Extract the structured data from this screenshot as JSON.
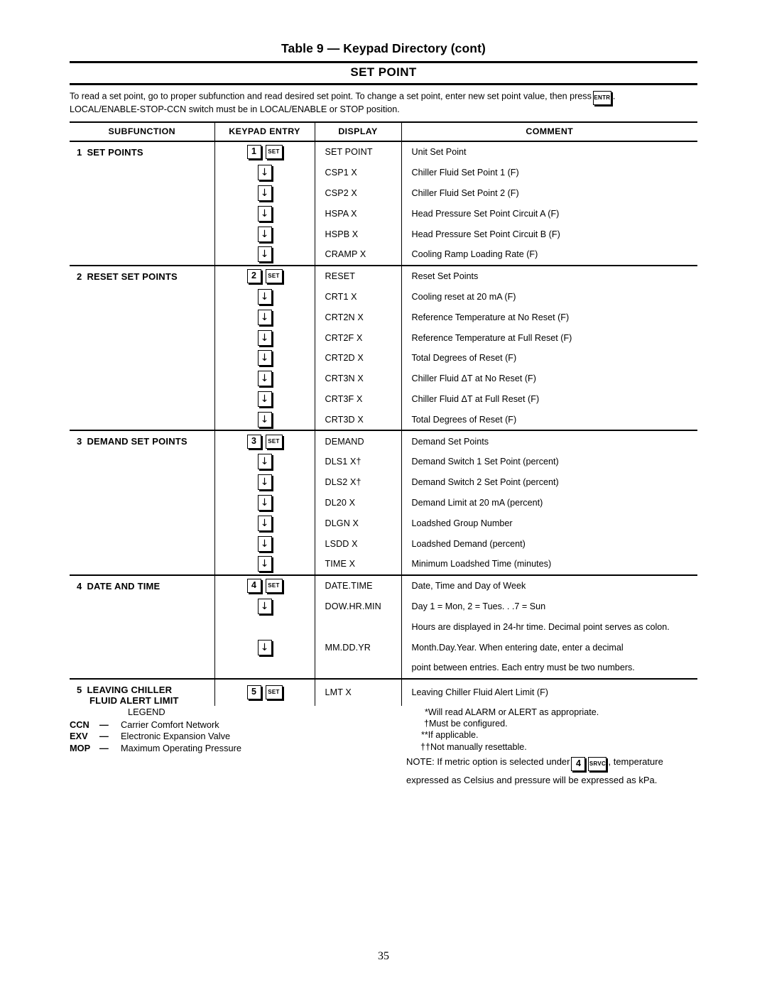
{
  "document": {
    "table_title": "Table 9 — Keypad Directory (cont)",
    "banner": "SET POINT",
    "page_number": "35",
    "intro_line1": "To read a set point, go to proper subfunction and read desired set point. To change a set point, enter new set point value, then press",
    "intro_after_key": ".",
    "intro_line2": "LOCAL/ENABLE-STOP-CCN switch must be in LOCAL/ENABLE or STOP position.",
    "intro_key": "ENTR"
  },
  "table": {
    "headers": {
      "subfunction": "SUBFUNCTION",
      "keypad_entry": "KEYPAD ENTRY",
      "display": "DISPLAY",
      "comment": "COMMENT"
    },
    "sections": [
      {
        "num": "1",
        "name": "SET POINTS",
        "name_line2": "",
        "rows": [
          {
            "key_num": "1",
            "key_label": "SET",
            "key_arrow": "",
            "display": "SET POINT",
            "comment": "Unit Set Point"
          },
          {
            "key_num": "",
            "key_label": "",
            "key_arrow": "↓",
            "display": "CSP1 X",
            "comment": "Chiller Fluid Set Point 1 (F)"
          },
          {
            "key_num": "",
            "key_label": "",
            "key_arrow": "↓",
            "display": "CSP2 X",
            "comment": "Chiller Fluid Set Point 2 (F)"
          },
          {
            "key_num": "",
            "key_label": "",
            "key_arrow": "↓",
            "display": "HSPA X",
            "comment": "Head Pressure Set Point Circuit A (F)"
          },
          {
            "key_num": "",
            "key_label": "",
            "key_arrow": "↓",
            "display": "HSPB X",
            "comment": "Head Pressure Set Point Circuit B (F)"
          },
          {
            "key_num": "",
            "key_label": "",
            "key_arrow": "↓",
            "display": "CRAMP X",
            "comment": "Cooling Ramp Loading Rate (F)"
          }
        ]
      },
      {
        "num": "2",
        "name": "RESET SET POINTS",
        "name_line2": "",
        "rows": [
          {
            "key_num": "2",
            "key_label": "SET",
            "key_arrow": "",
            "display": "RESET",
            "comment": "Reset Set Points"
          },
          {
            "key_num": "",
            "key_label": "",
            "key_arrow": "↓",
            "display": "CRT1 X",
            "comment": "Cooling reset at 20 mA (F)"
          },
          {
            "key_num": "",
            "key_label": "",
            "key_arrow": "↓",
            "display": "CRT2N X",
            "comment": "Reference Temperature at No Reset (F)"
          },
          {
            "key_num": "",
            "key_label": "",
            "key_arrow": "↓",
            "display": "CRT2F X",
            "comment": "Reference Temperature at Full Reset (F)"
          },
          {
            "key_num": "",
            "key_label": "",
            "key_arrow": "↓",
            "display": "CRT2D X",
            "comment": "Total Degrees of Reset (F)"
          },
          {
            "key_num": "",
            "key_label": "",
            "key_arrow": "↓",
            "display": "CRT3N X",
            "comment": "Chiller Fluid ΔT at No Reset (F)"
          },
          {
            "key_num": "",
            "key_label": "",
            "key_arrow": "↓",
            "display": "CRT3F X",
            "comment": "Chiller Fluid ΔT at Full Reset (F)"
          },
          {
            "key_num": "",
            "key_label": "",
            "key_arrow": "↓",
            "display": "CRT3D X",
            "comment": "Total Degrees of Reset (F)"
          }
        ]
      },
      {
        "num": "3",
        "name": "DEMAND SET POINTS",
        "name_line2": "",
        "rows": [
          {
            "key_num": "3",
            "key_label": "SET",
            "key_arrow": "",
            "display": "DEMAND",
            "comment": "Demand Set Points"
          },
          {
            "key_num": "",
            "key_label": "",
            "key_arrow": "↓",
            "display": "DLS1 X†",
            "comment": "Demand Switch 1 Set Point (percent)"
          },
          {
            "key_num": "",
            "key_label": "",
            "key_arrow": "↓",
            "display": "DLS2 X†",
            "comment": "Demand Switch 2 Set Point (percent)"
          },
          {
            "key_num": "",
            "key_label": "",
            "key_arrow": "↓",
            "display": "DL20 X",
            "comment": "Demand Limit at 20 mA (percent)"
          },
          {
            "key_num": "",
            "key_label": "",
            "key_arrow": "↓",
            "display": "DLGN X",
            "comment": "Loadshed Group Number"
          },
          {
            "key_num": "",
            "key_label": "",
            "key_arrow": "↓",
            "display": "LSDD X",
            "comment": "Loadshed Demand (percent)"
          },
          {
            "key_num": "",
            "key_label": "",
            "key_arrow": "↓",
            "display": "TIME X",
            "comment": "Minimum Loadshed Time (minutes)"
          }
        ]
      },
      {
        "num": "4",
        "name": "DATE AND TIME",
        "name_line2": "",
        "rows": [
          {
            "key_num": "4",
            "key_label": "SET",
            "key_arrow": "",
            "display": "DATE.TIME",
            "comment": "Date, Time and Day of Week"
          },
          {
            "key_num": "",
            "key_label": "",
            "key_arrow": "↓",
            "display": "DOW.HR.MIN",
            "comment": "Day 1 = Mon, 2 = Tues. . .7 = Sun"
          },
          {
            "key_num": "",
            "key_label": "",
            "key_arrow": "",
            "display": "",
            "comment": "Hours are displayed in 24-hr time. Decimal point serves as colon."
          },
          {
            "key_num": "",
            "key_label": "",
            "key_arrow": "↓",
            "display": "MM.DD.YR",
            "comment": "Month.Day.Year. When entering date, enter a decimal"
          },
          {
            "key_num": "",
            "key_label": "",
            "key_arrow": "",
            "display": "",
            "comment": "point between entries. Each entry must be two numbers."
          }
        ]
      },
      {
        "num": "5",
        "name": "LEAVING CHILLER",
        "name_line2": "FLUID ALERT LIMIT",
        "rows": [
          {
            "key_num": "5",
            "key_label": "SET",
            "key_arrow": "",
            "display": "LMT X",
            "comment": "Leaving Chiller Fluid Alert Limit (F)"
          }
        ]
      }
    ]
  },
  "legend": {
    "title": "LEGEND",
    "entries": [
      {
        "abbr": "CCN",
        "dash": "—",
        "text": "Carrier Comfort Network"
      },
      {
        "abbr": "EXV",
        "dash": "—",
        "text": "Electronic Expansion Valve"
      },
      {
        "abbr": "MOP",
        "dash": "—",
        "text": "Maximum Operating Pressure"
      }
    ]
  },
  "footnotes": [
    "*Will read ALARM or ALERT as appropriate.",
    "†Must be configured.",
    "**If applicable.",
    "††Not manually resettable."
  ],
  "note": {
    "prefix": "NOTE:  If  metric  option  is  selected  under",
    "key_num": "4",
    "key_label": "SRVC",
    "middle": ",  temperature",
    "line2": "expressed as Celsius and pressure will be expressed as kPa."
  }
}
